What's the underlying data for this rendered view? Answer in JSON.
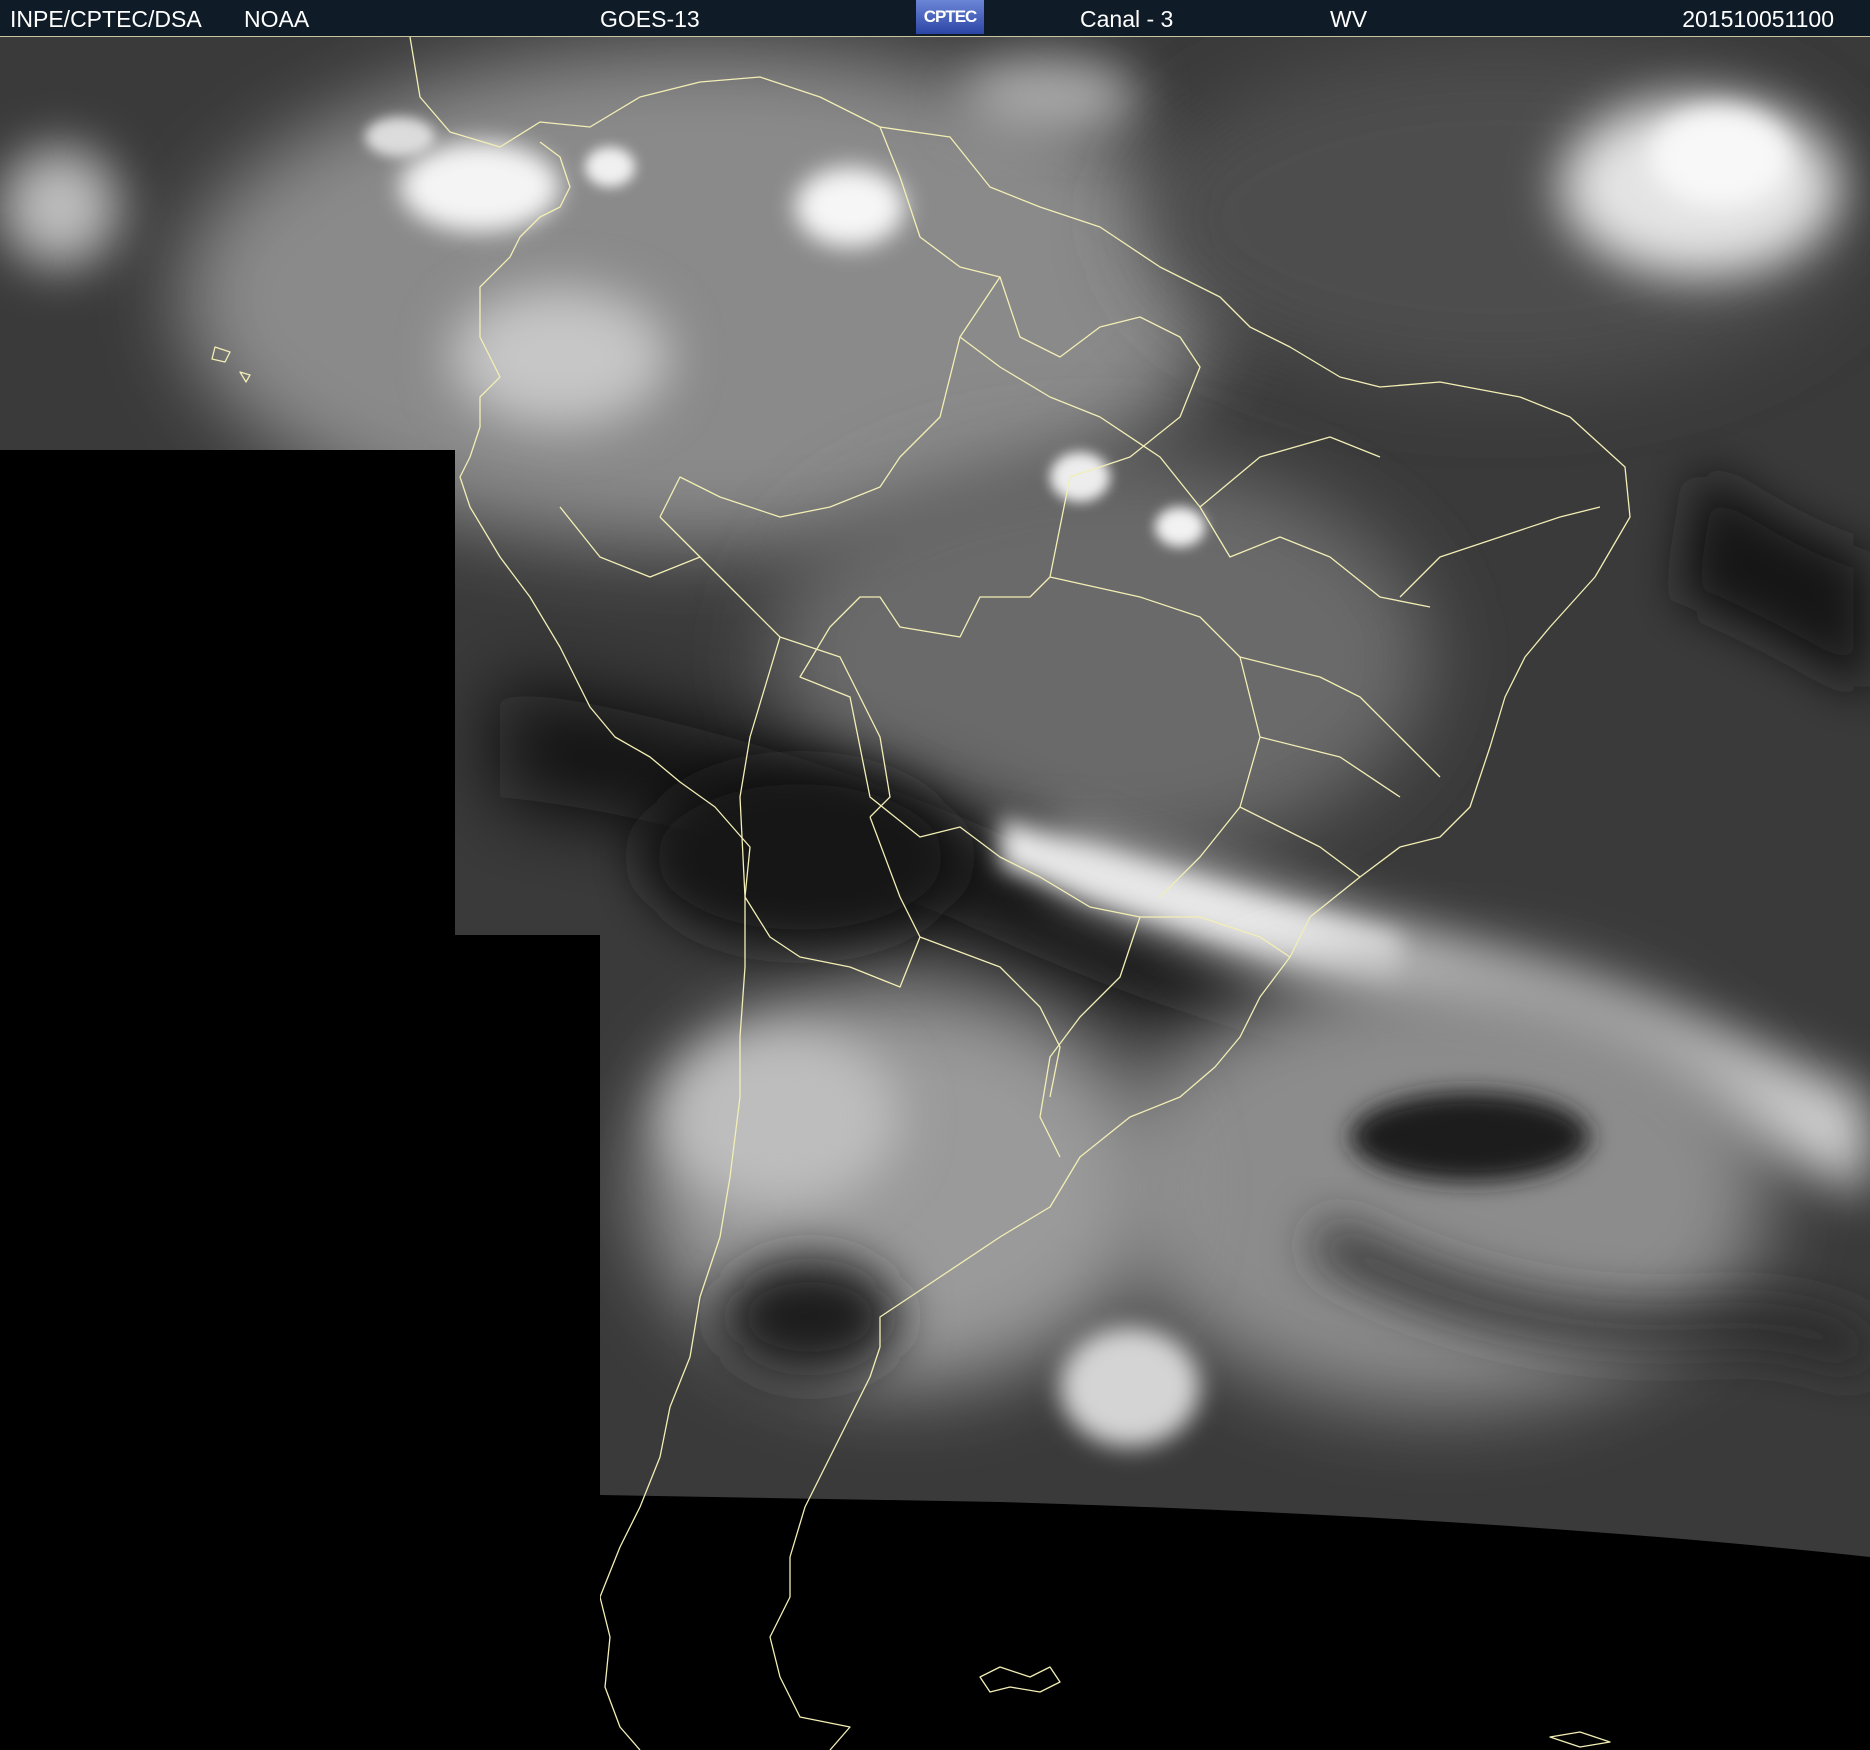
{
  "header": {
    "organization": "INPE/CPTEC/DSA",
    "agency": "NOAA",
    "satellite": "GOES-13",
    "logo_text": "CPTEC",
    "channel": "Canal - 3",
    "band": "WV",
    "timestamp": "201510051100"
  },
  "colors": {
    "header_background": "#0f1c27",
    "coastline": "#f2eeb5",
    "no_data": "#000000"
  },
  "image": {
    "type": "water vapor satellite imagery",
    "region": "South America"
  }
}
